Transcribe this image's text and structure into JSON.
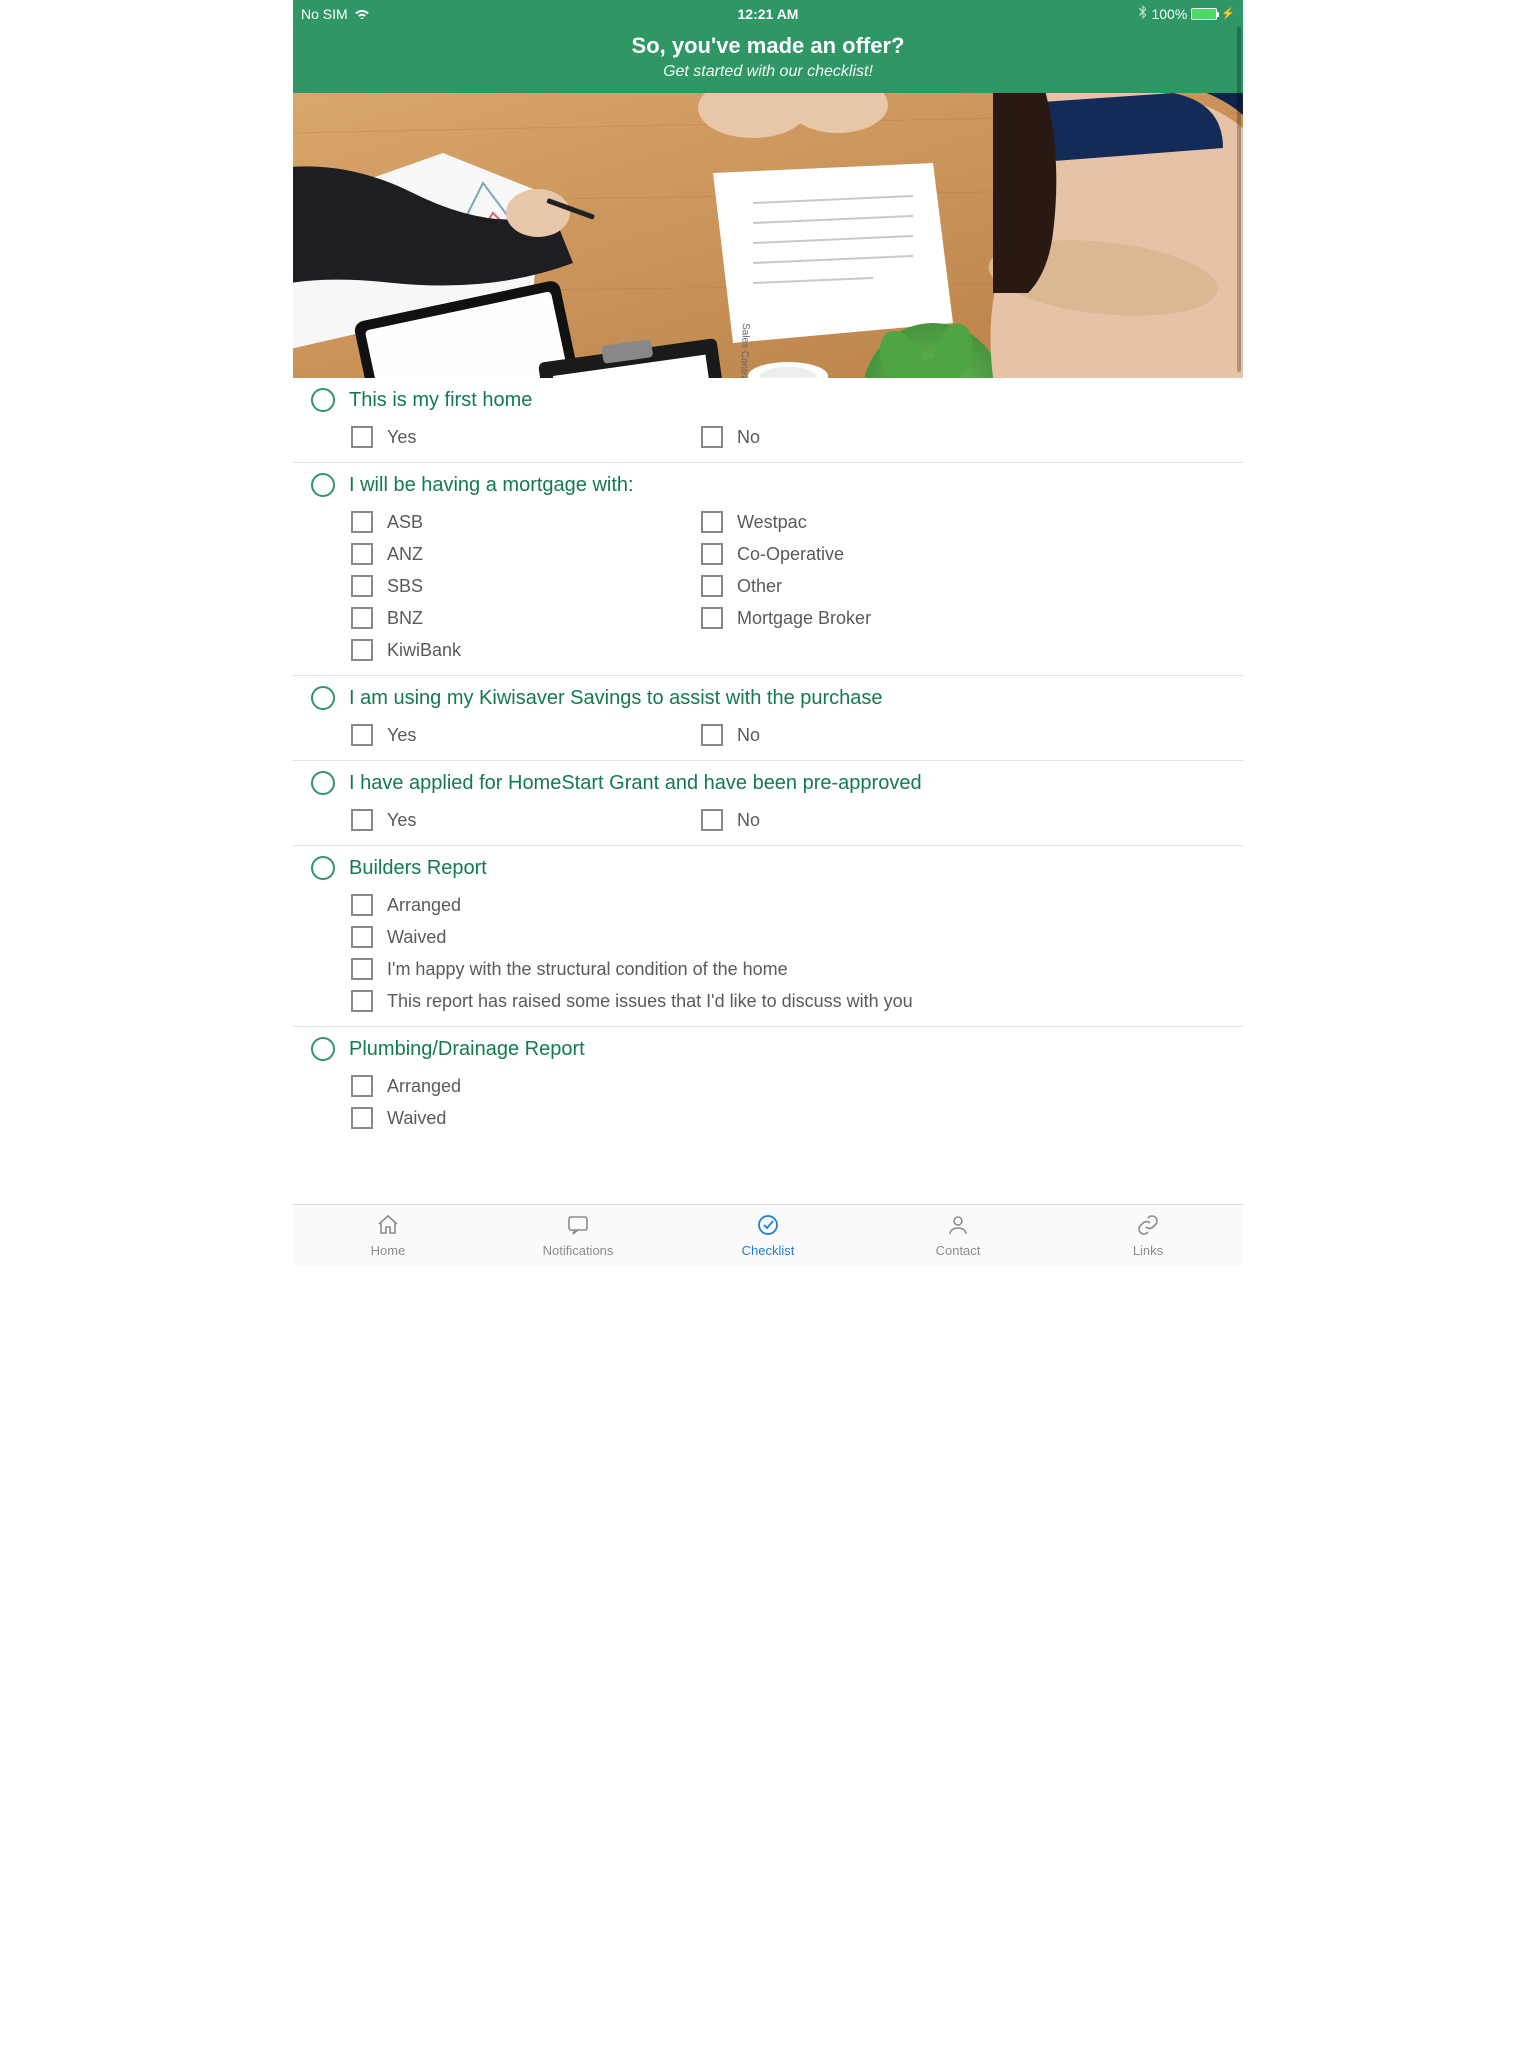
{
  "status": {
    "carrier": "No SIM",
    "time": "12:21 AM",
    "battery_pct": "100%"
  },
  "header": {
    "title": "So, you've made an offer?",
    "subtitle": "Get started with our checklist!"
  },
  "sections": [
    {
      "title": "This is my first home",
      "layout": "two-col",
      "options": [
        "Yes",
        "No"
      ]
    },
    {
      "title": "I will be having a mortgage with:",
      "layout": "two-col",
      "options": [
        "ASB",
        "Westpac",
        "ANZ",
        "Co-Operative",
        "SBS",
        "Other",
        "BNZ",
        "Mortgage Broker",
        "KiwiBank"
      ]
    },
    {
      "title": "I am using my Kiwisaver Savings to assist with the purchase",
      "layout": "two-col",
      "options": [
        "Yes",
        "No"
      ]
    },
    {
      "title": "I have applied for HomeStart Grant and have been pre-approved",
      "layout": "two-col",
      "options": [
        "Yes",
        "No"
      ]
    },
    {
      "title": "Builders Report",
      "layout": "one-col",
      "options": [
        "Arranged",
        "Waived",
        "I'm happy with the structural condition of the home",
        "This report has raised some issues that I'd like to discuss with you"
      ]
    },
    {
      "title": "Plumbing/Drainage Report",
      "layout": "one-col",
      "options": [
        "Arranged",
        "Waived"
      ]
    }
  ],
  "tabs": [
    {
      "label": "Home"
    },
    {
      "label": "Notifications"
    },
    {
      "label": "Checklist"
    },
    {
      "label": "Contact"
    },
    {
      "label": "Links"
    }
  ],
  "active_tab": 2
}
